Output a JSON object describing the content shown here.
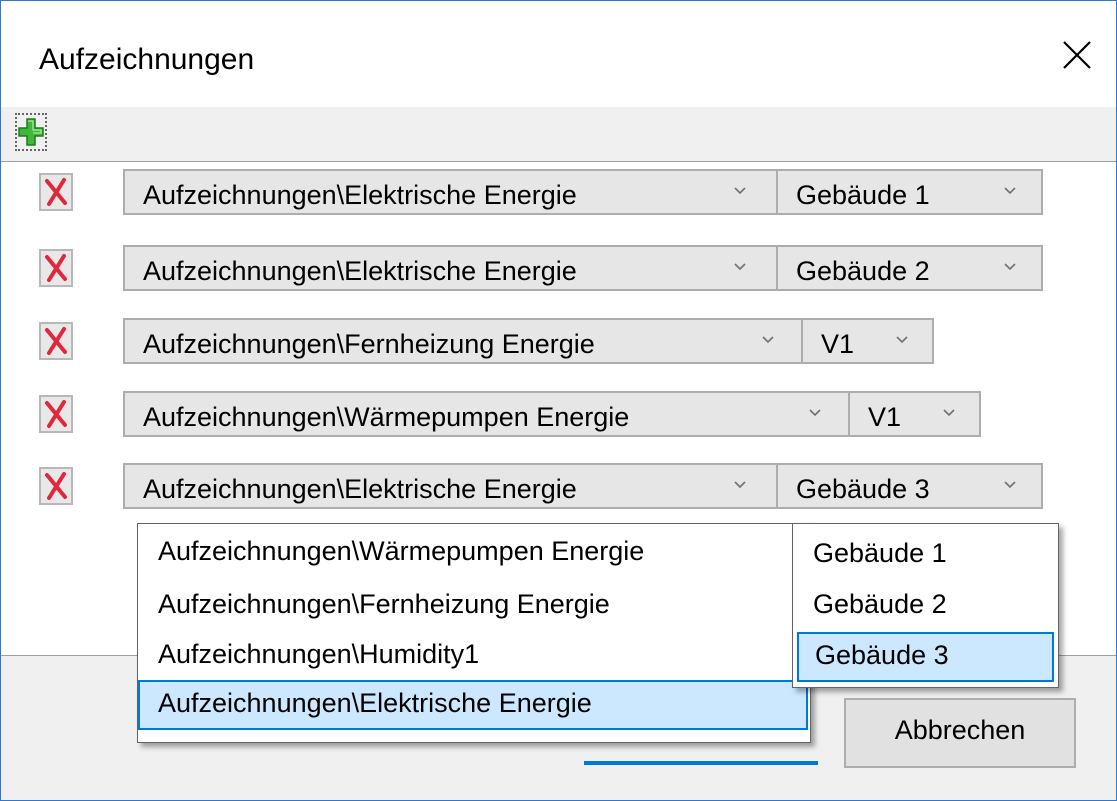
{
  "window": {
    "title": "Aufzeichnungen"
  },
  "icons": {
    "close": "close-icon",
    "add": "add-icon",
    "remove": "remove-icon",
    "chevron": "chevron-down-icon"
  },
  "colors": {
    "accent": "#0078d7",
    "selection": "#cce8ff",
    "remove_x": "#e0283a",
    "add_plus": "#3fb83a"
  },
  "rows": [
    {
      "recording": "Aufzeichnungen\\Elektrische Energie",
      "target": "Gebäude 1"
    },
    {
      "recording": "Aufzeichnungen\\Elektrische Energie",
      "target": "Gebäude 2"
    },
    {
      "recording": "Aufzeichnungen\\Fernheizung Energie",
      "target": "V1"
    },
    {
      "recording": "Aufzeichnungen\\Wärmepumpen Energie",
      "target": "V1"
    },
    {
      "recording": "Aufzeichnungen\\Elektrische Energie",
      "target": "Gebäude 3"
    }
  ],
  "recording_dropdown": {
    "options": [
      "Aufzeichnungen\\Wärmepumpen Energie",
      "Aufzeichnungen\\Fernheizung Energie",
      "Aufzeichnungen\\Humidity1",
      "Aufzeichnungen\\Elektrische Energie"
    ],
    "selected": "Aufzeichnungen\\Elektrische Energie"
  },
  "target_dropdown": {
    "options": [
      "Gebäude 1",
      "Gebäude 2",
      "Gebäude 3"
    ],
    "selected": "Gebäude 3"
  },
  "buttons": {
    "cancel": "Abbrechen"
  }
}
